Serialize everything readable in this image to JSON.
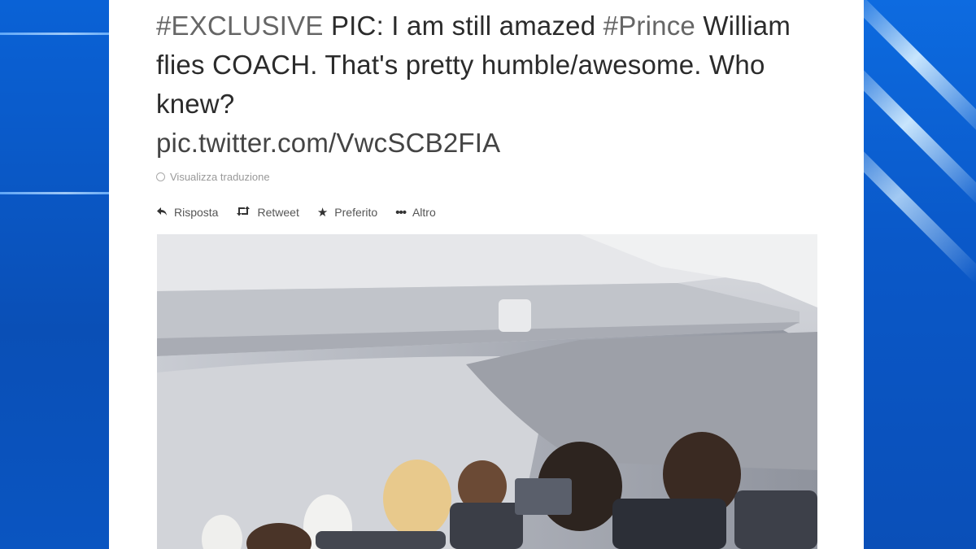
{
  "tweet": {
    "hashtag_exclusive": "#EXCLUSIVE",
    "text_part1": " PIC: I am still amazed ",
    "hashtag_prince": "#Prince",
    "text_part2": " William flies COACH. That's pretty humble/awesome. Who knew?",
    "link": "pic.twitter.com/VwcSCB2FIA",
    "translate_label": "Visualizza traduzione"
  },
  "actions": {
    "reply": "Risposta",
    "retweet": "Retweet",
    "favorite": "Preferito",
    "more": "Altro"
  },
  "icons": {
    "reply": "reply-arrow-icon",
    "retweet": "retweet-icon",
    "favorite": "star-icon",
    "more": "ellipsis-icon",
    "translate": "globe-icon"
  },
  "colors": {
    "background_blue": "#0b5fcf",
    "card": "#ffffff",
    "text": "#2b2b2b"
  }
}
